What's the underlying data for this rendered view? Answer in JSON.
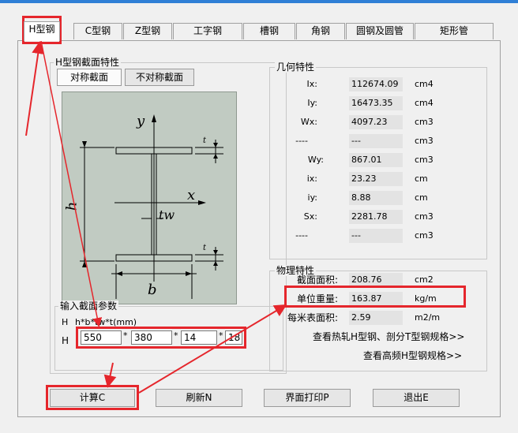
{
  "tabs": [
    "H型钢",
    "C型钢",
    "Z型钢",
    "工字钢",
    "槽钢",
    "角钢",
    "圆钢及圆管",
    "矩形管"
  ],
  "section_group": {
    "title": "H型钢截面特性",
    "btn_symmetric": "对称截面",
    "btn_asymmetric": "不对称截面"
  },
  "diagram": {
    "y": "y",
    "x": "x",
    "tw": "tw",
    "h": "h",
    "b": "b",
    "t": "t"
  },
  "geometry": {
    "title": "几何特性",
    "rows": [
      {
        "label": "Ix:",
        "value": "112674.09",
        "unit": "cm4"
      },
      {
        "label": "Iy:",
        "value": "16473.35",
        "unit": "cm4"
      },
      {
        "label": "Wx:",
        "value": "4097.23",
        "unit": "cm3"
      },
      {
        "label": "----",
        "value": "---",
        "unit": "cm3"
      },
      {
        "label": "Wy:",
        "value": "867.01",
        "unit": "cm3"
      },
      {
        "label": "ix:",
        "value": "23.23",
        "unit": "cm"
      },
      {
        "label": "iy:",
        "value": "8.88",
        "unit": "cm"
      },
      {
        "label": "Sx:",
        "value": "2281.78",
        "unit": "cm3"
      },
      {
        "label": "----",
        "value": "---",
        "unit": "cm3"
      }
    ]
  },
  "physical": {
    "title": "物理特性",
    "rows": [
      {
        "label": "截面面积:",
        "value": "208.76",
        "unit": "cm2"
      },
      {
        "label": "单位重量:",
        "value": "163.87",
        "unit": "kg/m"
      },
      {
        "label": "每米表面积:",
        "value": "2.59",
        "unit": "m2/m"
      }
    ],
    "link_hot_rolled": "查看热轧H型钢、剖分T型钢规格>>",
    "link_high_freq": "查看高频H型钢规格>>"
  },
  "input": {
    "title": "输入截面参数",
    "hint_prefix": "H",
    "hint_text": "h*b*tw*t(mm)",
    "row_label": "H",
    "values": [
      "550",
      "380",
      "14",
      "18"
    ],
    "sep": "*"
  },
  "buttons": {
    "calc": "计算C",
    "refresh": "刷新N",
    "print": "界面打印P",
    "exit": "退出E"
  },
  "colors": {
    "highlight": "#e5262c",
    "diagram_bg": "#c1cbc2",
    "accent": "#2f7fd6"
  }
}
